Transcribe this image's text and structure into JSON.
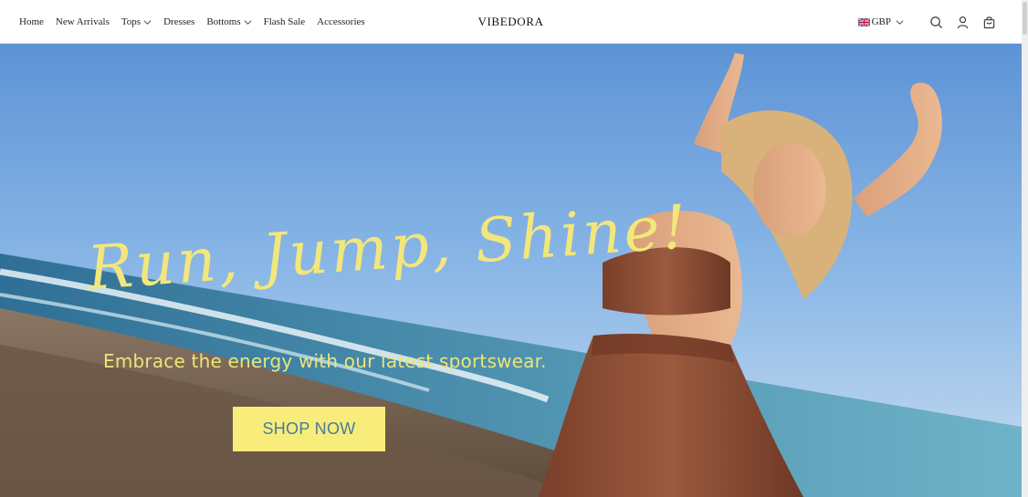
{
  "header": {
    "nav": [
      {
        "label": "Home",
        "has_dropdown": false
      },
      {
        "label": "New Arrivals",
        "has_dropdown": false
      },
      {
        "label": "Tops",
        "has_dropdown": true
      },
      {
        "label": "Dresses",
        "has_dropdown": false
      },
      {
        "label": "Bottoms",
        "has_dropdown": true
      },
      {
        "label": "Flash Sale",
        "has_dropdown": false
      },
      {
        "label": "Accessories",
        "has_dropdown": false
      }
    ],
    "brand": "VIBEDORA",
    "currency": {
      "code": "GBP",
      "flag": "uk-flag-icon"
    },
    "icons": [
      "search-icon",
      "account-icon",
      "cart-icon"
    ]
  },
  "hero": {
    "headline": "Run, Jump, Shine!",
    "subheadline": "Embrace the energy with our latest sportswear.",
    "cta_label": "SHOP NOW",
    "colors": {
      "headline": "#f3e77b",
      "cta_bg": "#f8ec7a",
      "cta_text": "#4a7a9a",
      "sky": "#6fa3d8",
      "sea": "#3d8fb0",
      "outfit": "#8a4a32"
    }
  }
}
